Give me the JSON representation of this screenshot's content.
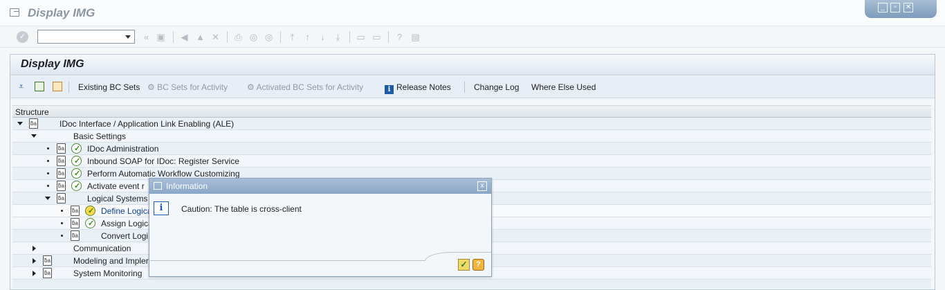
{
  "window": {
    "title": "Display IMG",
    "controls": [
      "minimize",
      "restore",
      "close"
    ]
  },
  "toolbar": {
    "command_field_value": "",
    "icons": [
      "enter-icon",
      "back-icon",
      "save-icon",
      "exit-icon",
      "cancel-icon",
      "print-icon",
      "find-icon",
      "find-next-icon",
      "first-page-icon",
      "previous-page-icon",
      "next-page-icon",
      "last-page-icon",
      "new-session-icon",
      "shortcut-icon",
      "help-icon",
      "customize-layout-icon"
    ]
  },
  "panel": {
    "title": "Display IMG"
  },
  "app_toolbar": {
    "existing_bc_sets": "Existing BC Sets",
    "bc_sets_for_activity": "BC Sets for Activity",
    "activated_bc_sets": "Activated BC Sets for Activity",
    "release_notes": "Release Notes",
    "change_log": "Change Log",
    "where_else_used": "Where Else Used"
  },
  "tree": {
    "header": "Structure",
    "rows": [
      {
        "label": "IDoc Interface / Application Link Enabling (ALE)",
        "toggle": "open",
        "doc": true,
        "clock": false
      },
      {
        "label": "Basic Settings",
        "toggle": "open",
        "doc": false,
        "clock": false
      },
      {
        "label": "IDoc Administration",
        "toggle": "bullet",
        "doc": true,
        "clock": true
      },
      {
        "label": "Inbound SOAP for IDoc: Register Service",
        "toggle": "bullet",
        "doc": true,
        "clock": true
      },
      {
        "label": "Perform Automatic Workflow Customizing",
        "toggle": "bullet",
        "doc": true,
        "clock": true
      },
      {
        "label": "Activate event r",
        "toggle": "bullet",
        "doc": true,
        "clock": true
      },
      {
        "label": "Logical Systems",
        "toggle": "open",
        "doc": true,
        "clock": false
      },
      {
        "label": "Define Logica",
        "toggle": "bullet",
        "doc": true,
        "clock": true
      },
      {
        "label": "Assign Logica",
        "toggle": "bullet",
        "doc": true,
        "clock": true
      },
      {
        "label": "Convert Logi",
        "toggle": "bullet",
        "doc": true,
        "clock": false
      },
      {
        "label": "Communication",
        "toggle": "closed",
        "doc": false,
        "clock": false
      },
      {
        "label": "Modeling and Impler",
        "toggle": "closed",
        "doc": true,
        "clock": false
      },
      {
        "label": "System Monitoring",
        "toggle": "closed",
        "doc": true,
        "clock": false
      }
    ]
  },
  "dialog": {
    "title": "Information",
    "message": "Caution: The table is cross-client",
    "close_label": "x"
  }
}
